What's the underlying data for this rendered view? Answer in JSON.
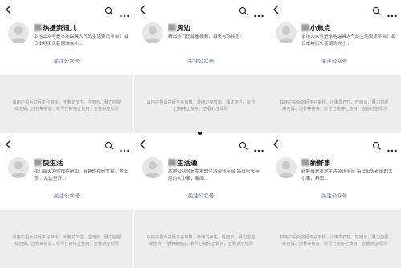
{
  "panels": [
    {
      "name_suffix": "热搜资讯儿",
      "description": "本地公众号是本地最具人气的生活资讯平台！每日本地街头巷尾的大小...",
      "follow_label": "关注公众号",
      "notice": "由用户投诉并经平台审核，涉嫌发布性、性暗示、暴力血腥或色情、淫秽等信息，帐号已被停止使用，查看对应规则"
    },
    {
      "name_suffix": "周边",
      "description": "精彩热门正能量视频，每天与你相见！",
      "follow_label": "关注公众号",
      "notice": "由用户投诉并经平台审核，涉嫌过度营销、骚扰用户，帐号已被停止使用，查看对应规则"
    },
    {
      "name_suffix": "小焦点",
      "description": "本地公众号是本地最具人气的生活资讯平台！每日本地街头巷尾的大小...",
      "follow_label": "关注公众号",
      "notice": "由用户投诉并经平台审核，涉嫌发布性、性暗示、暴力血腥或色情、淫秽等信息，帐号已被停止使用，查看对应规则"
    },
    {
      "name_suffix": "快生活",
      "description": "我们每天为你推荐新闻、有趣的视频文章。登上顶... 从这里开...",
      "follow_label": "关注公众号",
      "notice": "由用户投诉并经平台审核，涉嫌发布性、性暗示、暴力血腥或色情、淫秽等信息，帐号已被停止使用，查看对应规则"
    },
    {
      "name_suffix": "生活通",
      "description": "本地公众号是本地的生活资讯平台 每日街头巷尾的大小事，新闻...",
      "follow_label": "关注公众号",
      "notice": "由用户投诉并经平台审核，涉嫌发布性、性暗示、暴力血腥或色情、淫秽等信息，帐号已被停止使用，查看对应规则"
    },
    {
      "name_suffix": "新鲜事",
      "description": "新鲜事是本地生活资讯平台 每日街头巷尾的大小事，新闻...",
      "follow_label": "关注公众号",
      "notice": "由用户投诉并经平台审核，涉嫌发布性、性暗示、暴力血腥或色情、淫秽等信息，帐号已被停止使用，查看对应规则"
    }
  ]
}
